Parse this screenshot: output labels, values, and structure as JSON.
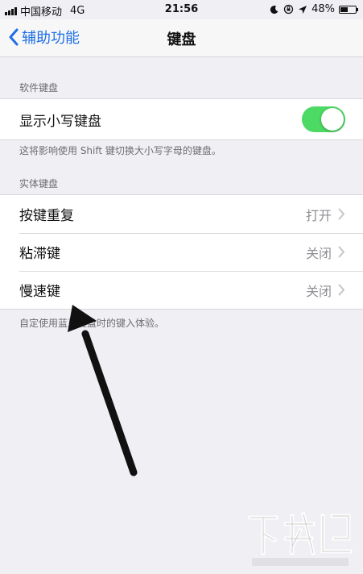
{
  "status_bar": {
    "carrier": "中国移动",
    "network": "4G",
    "time": "21:56",
    "battery_percent": "48%",
    "battery_level": 0.48
  },
  "nav": {
    "back_label": "辅助功能",
    "title": "键盘"
  },
  "software_keyboard": {
    "header": "软件键盘",
    "lowercase_label": "显示小写键盘",
    "lowercase_enabled": true,
    "footer": "这将影响使用 Shift 键切换大小写字母的键盘。"
  },
  "hardware_keyboard": {
    "header": "实体键盘",
    "rows": [
      {
        "label": "按键重复",
        "value": "打开"
      },
      {
        "label": "粘滞键",
        "value": "关闭"
      },
      {
        "label": "慢速键",
        "value": "关闭"
      }
    ],
    "footer": "自定使用蓝牙键盘时的键入体验。"
  },
  "colors": {
    "accent": "#1f6fe5",
    "toggle_on": "#4cd964",
    "background": "#efeff4"
  },
  "icons": {
    "back": "chevron-left-icon",
    "disclosure": "chevron-right-icon",
    "annotation": "arrow-annotation-icon"
  }
}
